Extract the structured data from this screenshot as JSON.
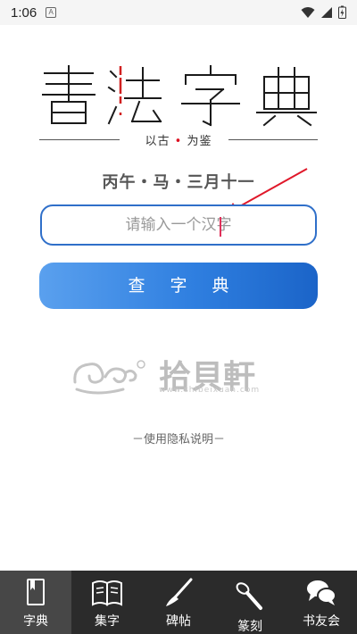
{
  "status_bar": {
    "time": "1:06",
    "notif_glyph": "A"
  },
  "logo": {
    "title": "書法字典",
    "tagline_left": "以古",
    "tagline_dot": "•",
    "tagline_right": "为鉴"
  },
  "lunar_date": "丙午・马・三月十一",
  "search": {
    "placeholder": "请输入一个汉字",
    "value": ""
  },
  "lookup_button": "查字典",
  "brand": {
    "name": "拾贝軒",
    "url": "www.shibeixuan.com"
  },
  "privacy_link": "－使用隐私说明－",
  "nav": [
    {
      "label": "字典",
      "icon": "book-icon",
      "active": true
    },
    {
      "label": "集字",
      "icon": "open-book-icon",
      "active": false
    },
    {
      "label": "碑帖",
      "icon": "brush-icon",
      "active": false
    },
    {
      "label": "篆刻",
      "icon": "carving-knife-icon",
      "active": false
    },
    {
      "label": "书友会",
      "icon": "chat-bubbles-icon",
      "active": false
    }
  ],
  "colors": {
    "accent_blue": "#2f6fc9",
    "nav_bg": "#2b2b2b",
    "highlight_red": "#d12020"
  }
}
